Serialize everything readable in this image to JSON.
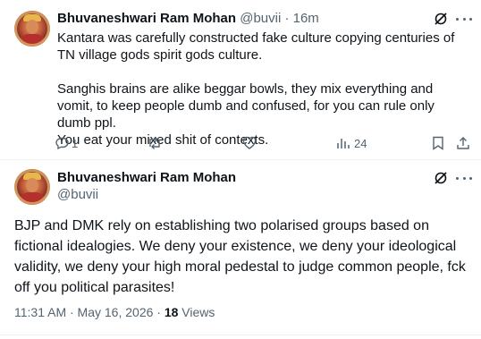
{
  "reply": {
    "author": "Bhuvaneshwari Ram Mohan",
    "handle_time": "@buvii · 16m",
    "text": "Kantara was carefully constructed fake culture copying centuries of TN village gods spirit gods culture.\n\nSanghis brains are alike beggar bowls, they mix everything and vomit, to keep people dumb and confused, for you can rule only dumb ppl.\nYou eat your mixed shit of contexts.",
    "replies": "1",
    "views": "24"
  },
  "main": {
    "author": "Bhuvaneshwari Ram Mohan",
    "handle": "@buvii",
    "text": "BJP and DMK rely on establishing two polarised groups based on fictional idealogies. We deny your existence, we deny your ideological validity, we deny your high moral pedestal to judge common people, fck off you political parasites!",
    "timestamp": "11:31 AM · May 16, 2026 · ",
    "view_count": "18",
    "views_label": " Views"
  },
  "colors": {
    "muted": "#536471",
    "divider": "#eff3f4",
    "text": "#0f1419"
  },
  "icons": [
    "grok-icon",
    "more-icon",
    "reply-icon",
    "retweet-icon",
    "like-icon",
    "views-icon",
    "bookmark-icon",
    "share-icon"
  ]
}
